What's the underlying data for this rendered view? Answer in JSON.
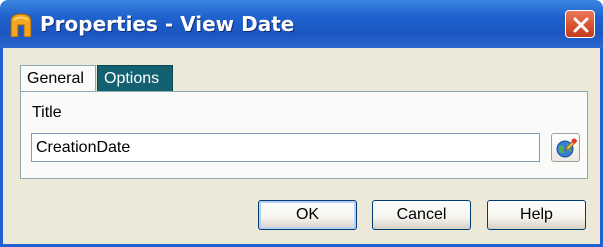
{
  "window": {
    "title": "Properties - View Date",
    "icons": {
      "app": "building-icon",
      "close": "close-x-icon"
    }
  },
  "tabs": [
    {
      "label": "General",
      "active": true
    },
    {
      "label": "Options",
      "active": false
    }
  ],
  "general": {
    "field_label": "Title",
    "title_value": "CreationDate",
    "browse_icon": "globe-edit-icon"
  },
  "buttons": {
    "ok": "OK",
    "cancel": "Cancel",
    "help": "Help"
  },
  "colors": {
    "titlebar": "#1f5fcf",
    "dialog_bg": "#ece9d8",
    "options_tab_bg": "#126070",
    "close_button": "#d8532e"
  }
}
